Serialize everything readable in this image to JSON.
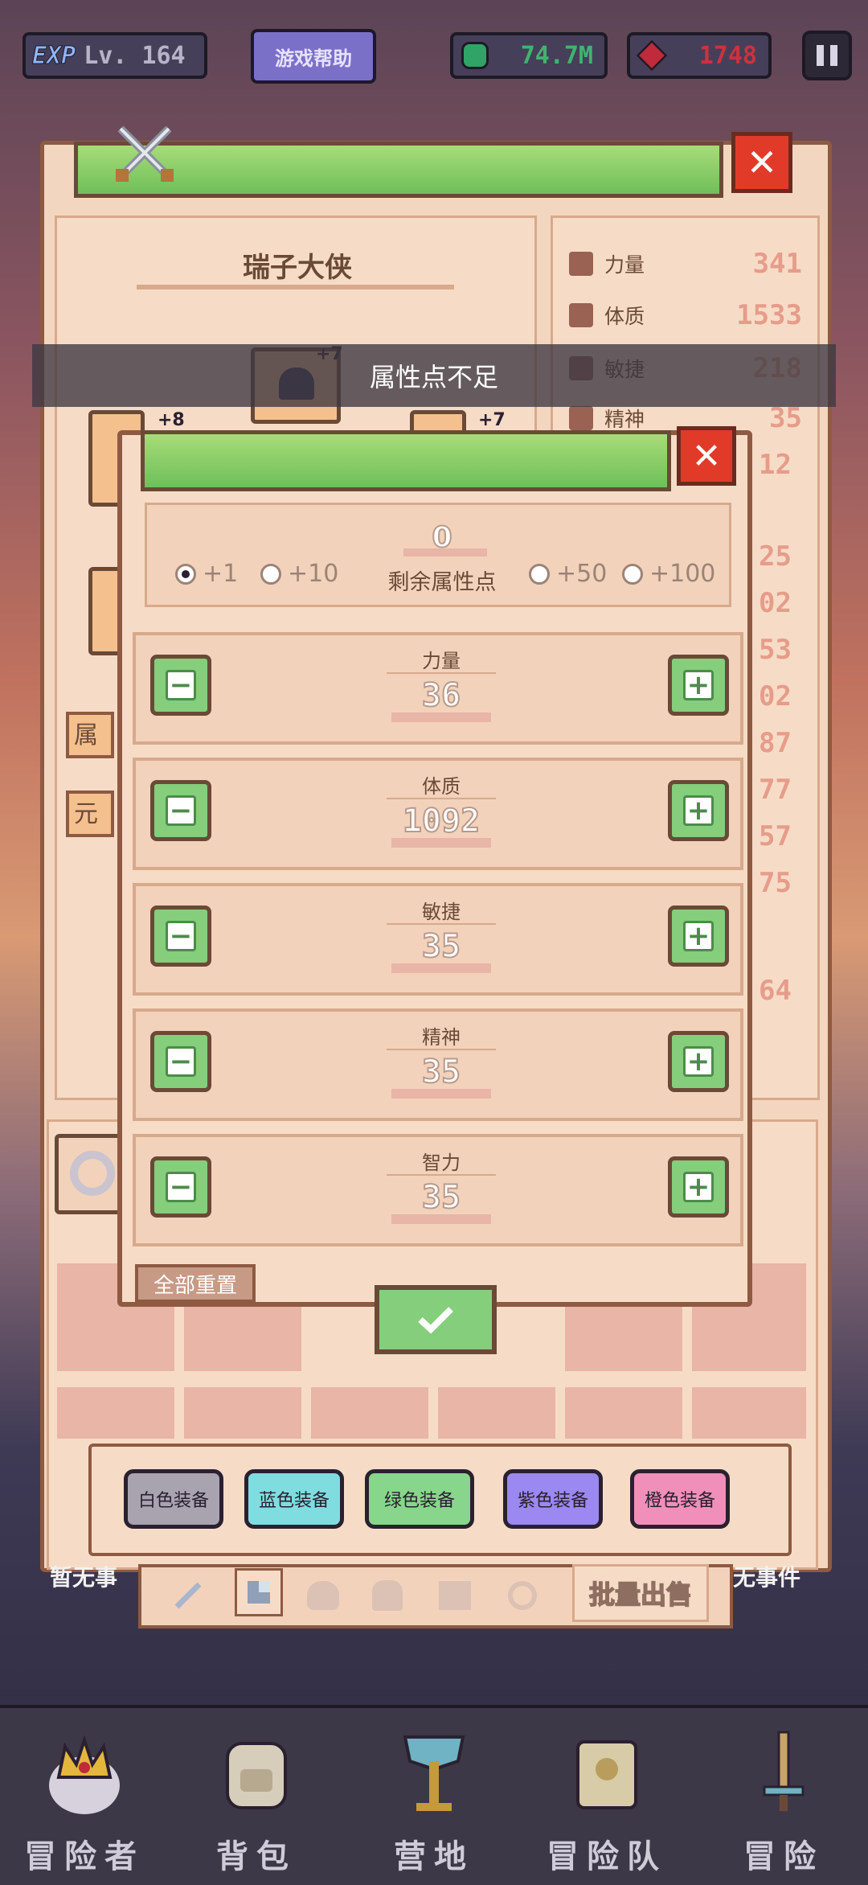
{
  "top_bar": {
    "exp_badge": "EXP",
    "level": "Lv. 164",
    "help_button": "游戏帮助",
    "gems": "74.7M",
    "rubies": "1748"
  },
  "hero": {
    "name": "瑞子大侠",
    "slot_plus": [
      "+7",
      "+8",
      "+7"
    ],
    "side_tabs": [
      "属性",
      "元素"
    ]
  },
  "stats_panel": [
    {
      "name": "力量",
      "value": "341"
    },
    {
      "name": "体质",
      "value": "1533"
    },
    {
      "name": "敏捷",
      "value": "218"
    },
    {
      "name": "精神",
      "value": "35"
    }
  ],
  "side_values": [
    "12",
    "25",
    "02",
    "53",
    "02",
    "87",
    "77",
    "57",
    "75",
    "64"
  ],
  "toast": "属性点不足",
  "dialog": {
    "remaining_points_value": "0",
    "remaining_points_label": "剩余属性点",
    "step_options": [
      {
        "label": "+1",
        "selected": true
      },
      {
        "label": "+10",
        "selected": false
      },
      {
        "label": "+50",
        "selected": false
      },
      {
        "label": "+100",
        "selected": false
      }
    ],
    "attributes": [
      {
        "name": "力量",
        "value": "36"
      },
      {
        "name": "体质",
        "value": "1092"
      },
      {
        "name": "敏捷",
        "value": "35"
      },
      {
        "name": "精神",
        "value": "35"
      },
      {
        "name": "智力",
        "value": "35"
      }
    ],
    "reset_all": "全部重置"
  },
  "filters": [
    {
      "label": "白色装备",
      "color": "#a9a3b0"
    },
    {
      "label": "蓝色装备",
      "color": "#7fdde0"
    },
    {
      "label": "绿色装备",
      "color": "#88d68b"
    },
    {
      "label": "紫色装备",
      "color": "#9b88f0"
    },
    {
      "label": "橙色装备",
      "color": "#f08fb9"
    }
  ],
  "batch_sell": "批量出售",
  "side_labels": {
    "left": "暂无事",
    "right": "无事件"
  },
  "bottom_nav": [
    {
      "label": "冒险者",
      "icon": "crown-icon"
    },
    {
      "label": "背包",
      "icon": "backpack-icon"
    },
    {
      "label": "营地",
      "icon": "camp-banner-icon"
    },
    {
      "label": "冒险队",
      "icon": "book-icon"
    },
    {
      "label": "冒险",
      "icon": "sword-icon"
    }
  ],
  "colors": {
    "panel": "#f3d6bf",
    "border": "#8e5a42",
    "title_green": "#79c45f",
    "close_red": "#e23a29",
    "stat_value": "#e79c8a"
  }
}
